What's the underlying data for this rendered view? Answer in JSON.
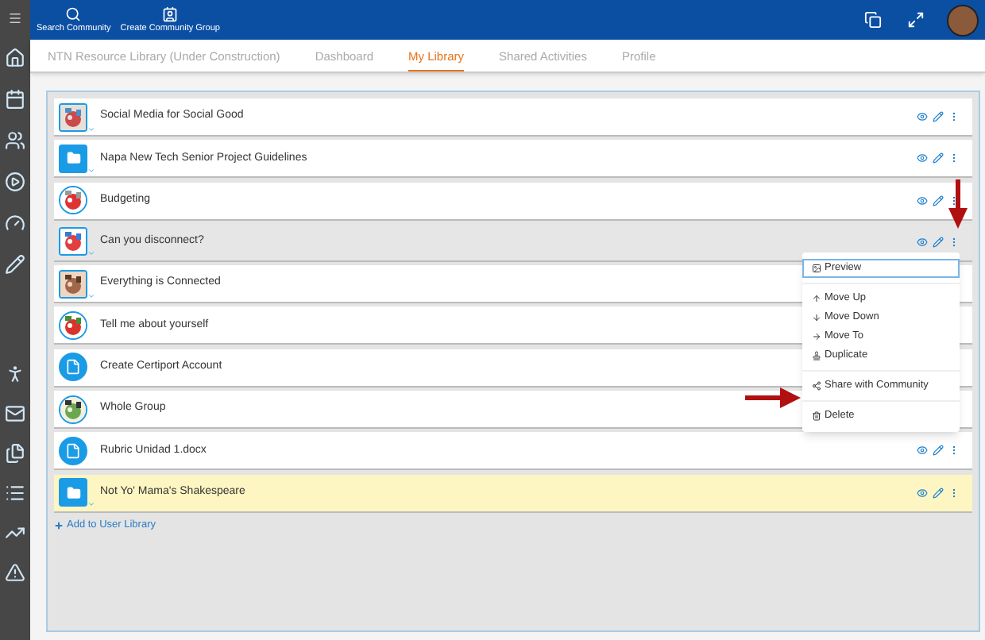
{
  "top_bar": {
    "actions": [
      {
        "kind": "search",
        "label": "Search Community"
      },
      {
        "kind": "group",
        "label": "Create Community Group"
      }
    ]
  },
  "tabs": [
    {
      "label": "NTN Resource Library (Under Construction)",
      "selected": false
    },
    {
      "label": "Dashboard",
      "selected": false
    },
    {
      "label": "My Library",
      "selected": true
    },
    {
      "label": "Shared Activities",
      "selected": false
    },
    {
      "label": "Profile",
      "selected": false
    }
  ],
  "library": {
    "items": [
      {
        "title": "Social Media for Social Good",
        "kind": "picture",
        "round": false,
        "expandable": true,
        "selected": false,
        "highlighted": false,
        "actions_shown": true
      },
      {
        "title": "Napa New Tech Senior Project Guidelines",
        "kind": "folder",
        "round": false,
        "expandable": true,
        "selected": false,
        "highlighted": false,
        "actions_shown": true
      },
      {
        "title": "Budgeting",
        "kind": "picture",
        "round": true,
        "expandable": false,
        "selected": false,
        "highlighted": false,
        "actions_shown": true
      },
      {
        "title": "Can you disconnect?",
        "kind": "picture",
        "round": false,
        "expandable": true,
        "selected": true,
        "highlighted": false,
        "actions_shown": true
      },
      {
        "title": "Everything is Connected",
        "kind": "picture",
        "round": false,
        "expandable": true,
        "selected": false,
        "highlighted": false,
        "actions_shown": false
      },
      {
        "title": "Tell me about yourself",
        "kind": "picture",
        "round": true,
        "expandable": false,
        "selected": false,
        "highlighted": false,
        "actions_shown": false
      },
      {
        "title": "Create Certiport Account",
        "kind": "document",
        "round": true,
        "expandable": false,
        "selected": false,
        "highlighted": false,
        "actions_shown": false
      },
      {
        "title": "Whole Group",
        "kind": "picture",
        "round": true,
        "expandable": false,
        "selected": false,
        "highlighted": false,
        "actions_shown": false
      },
      {
        "title": "Rubric Unidad 1.docx",
        "kind": "document",
        "round": true,
        "expandable": false,
        "selected": false,
        "highlighted": false,
        "actions_shown": true
      },
      {
        "title": "Not Yo' Mama's Shakespeare",
        "kind": "folder",
        "round": false,
        "expandable": true,
        "selected": false,
        "highlighted": true,
        "actions_shown": true
      }
    ],
    "add_link": "Add to User Library"
  },
  "context_menu": {
    "groups": [
      [
        {
          "kind": "preview",
          "label": "Preview",
          "selected": true
        }
      ],
      [
        {
          "kind": "up",
          "label": "Move Up",
          "selected": false
        },
        {
          "kind": "down",
          "label": "Move Down",
          "selected": false
        },
        {
          "kind": "to",
          "label": "Move To",
          "selected": false
        },
        {
          "kind": "duplicate",
          "label": "Duplicate",
          "selected": false
        }
      ],
      [
        {
          "kind": "share",
          "label": "Share with Community",
          "selected": false
        }
      ],
      [
        {
          "kind": "delete",
          "label": "Delete",
          "selected": false
        }
      ]
    ]
  }
}
